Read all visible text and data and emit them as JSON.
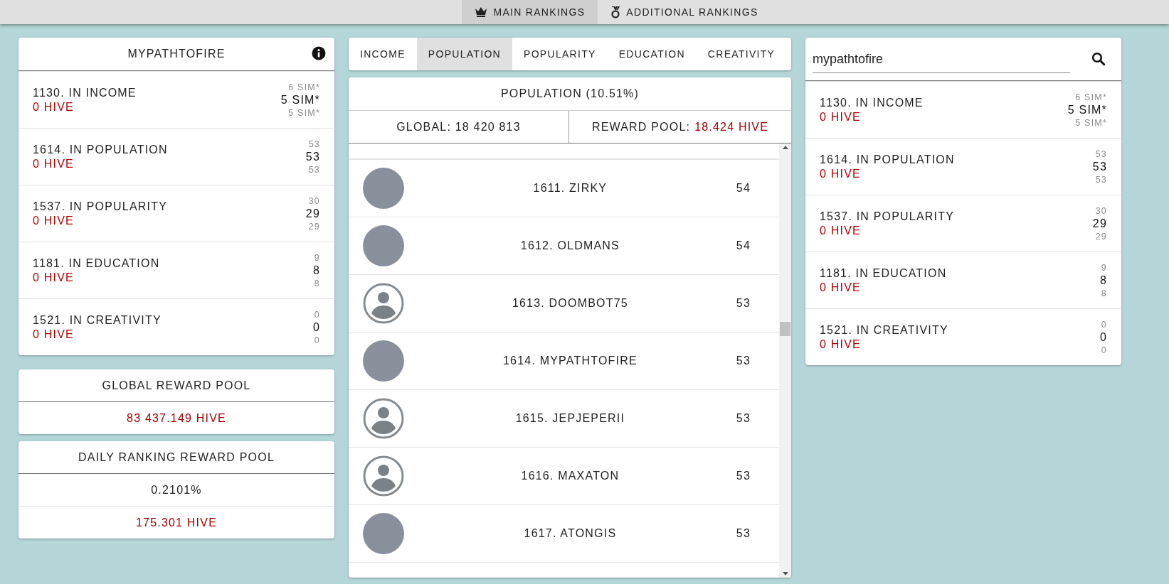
{
  "top_nav": {
    "tabs": [
      {
        "label": "MAIN RANKINGS",
        "selected": true
      },
      {
        "label": "ADDITIONAL RANKINGS",
        "selected": false
      }
    ]
  },
  "user_card": {
    "title": "MYPATHTOFIRE",
    "stats": [
      {
        "label": "1130. IN INCOME",
        "reward": "0 HIVE",
        "above": "6 SIM*",
        "value": "5 SIM*",
        "below": "5 SIM*"
      },
      {
        "label": "1614. IN POPULATION",
        "reward": "0 HIVE",
        "above": "53",
        "value": "53",
        "below": "53"
      },
      {
        "label": "1537. IN POPULARITY",
        "reward": "0 HIVE",
        "above": "30",
        "value": "29",
        "below": "29"
      },
      {
        "label": "1181. IN EDUCATION",
        "reward": "0 HIVE",
        "above": "9",
        "value": "8",
        "below": "8"
      },
      {
        "label": "1521. IN CREATIVITY",
        "reward": "0 HIVE",
        "above": "0",
        "value": "0",
        "below": "0"
      }
    ]
  },
  "global_reward_pool": {
    "title": "GLOBAL REWARD POOL",
    "rows": [
      {
        "text": "83 437.149 HIVE",
        "kind": "hive"
      }
    ]
  },
  "daily_reward_pool": {
    "title": "DAILY RANKING REWARD POOL",
    "rows": [
      {
        "text": "0.2101%",
        "kind": "plain"
      },
      {
        "text": "175.301 HIVE",
        "kind": "hive"
      }
    ]
  },
  "category_tabs": [
    {
      "label": "INCOME",
      "selected": false
    },
    {
      "label": "POPULATION",
      "selected": true
    },
    {
      "label": "POPULARITY",
      "selected": false
    },
    {
      "label": "EDUCATION",
      "selected": false
    },
    {
      "label": "CREATIVITY",
      "selected": false
    }
  ],
  "ranking": {
    "title": "POPULATION (10.51%)",
    "global_label": "GLOBAL: 18 420 813",
    "pool_label": "REWARD POOL:",
    "pool_value": "18.424 HIVE",
    "rows": [
      {
        "name": "1611. ZIRKY",
        "value": "54",
        "kind": "photo"
      },
      {
        "name": "1612. OLDMANS",
        "value": "54",
        "kind": "photo"
      },
      {
        "name": "1613. DOOMBOT75",
        "value": "53",
        "kind": "default"
      },
      {
        "name": "1614. MYPATHTOFIRE",
        "value": "53",
        "kind": "photo"
      },
      {
        "name": "1615. JEPJEPERII",
        "value": "53",
        "kind": "default"
      },
      {
        "name": "1616. MAXATON",
        "value": "53",
        "kind": "default"
      },
      {
        "name": "1617. ATONGIS",
        "value": "53",
        "kind": "photo"
      }
    ]
  },
  "search_card": {
    "search": {
      "value": "mypathtofire"
    },
    "stats": [
      {
        "label": "1130. IN INCOME",
        "reward": "0 HIVE",
        "above": "6 SIM*",
        "value": "5 SIM*",
        "below": "5 SIM*"
      },
      {
        "label": "1614. IN POPULATION",
        "reward": "0 HIVE",
        "above": "53",
        "value": "53",
        "below": "53"
      },
      {
        "label": "1537. IN POPULARITY",
        "reward": "0 HIVE",
        "above": "30",
        "value": "29",
        "below": "29"
      },
      {
        "label": "1181. IN EDUCATION",
        "reward": "0 HIVE",
        "above": "9",
        "value": "8",
        "below": "8"
      },
      {
        "label": "1521. IN CREATIVITY",
        "reward": "0 HIVE",
        "above": "0",
        "value": "0",
        "below": "0"
      }
    ]
  }
}
